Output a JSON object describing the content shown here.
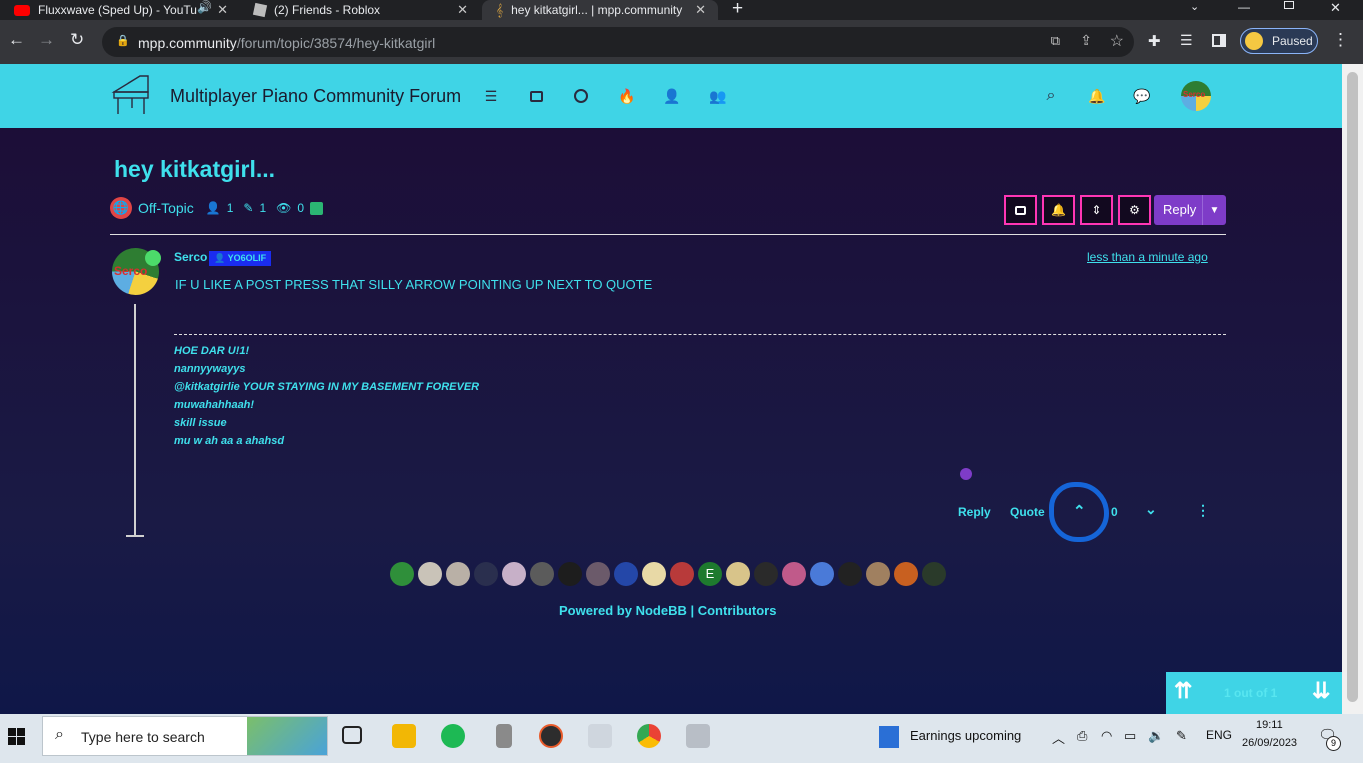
{
  "browser": {
    "tabs": [
      {
        "title": "Fluxxwave (Sped Up) - YouTu"
      },
      {
        "title": "(2) Friends - Roblox"
      },
      {
        "title": "hey kitkatgirl... | mpp.community"
      }
    ],
    "url_domain": "mpp.community",
    "url_path": "/forum/topic/38574/hey-kitkatgirl",
    "profile_label": "Paused"
  },
  "forum": {
    "brand": "Multiplayer Piano Community Forum",
    "nav_icons": [
      "list-icon",
      "inbox-icon",
      "clock-icon",
      "fire-icon",
      "user-icon",
      "users-icon"
    ],
    "header_right_icons": [
      "search-icon",
      "bell-icon",
      "chat-icon"
    ],
    "avatar_text": "Serco"
  },
  "topic": {
    "title": "hey kitkatgirl...",
    "category": "Off-Topic",
    "posters": "1",
    "posts": "1",
    "views": "0",
    "reply_label": "Reply"
  },
  "post": {
    "author": "Serco",
    "badge": "YO6OLIF",
    "time": "less than a minute ago",
    "content": "IF U LIKE A POST PRESS THAT SILLY ARROW POINTING UP NEXT TO QUOTE",
    "signature": [
      "HOE DAR U!1!",
      "nannyywayys",
      "@kitkatgirlie YOUR STAYING IN MY BASEMENT FOREVER",
      "muwahahhaah!",
      "skill issue",
      "mu w ah aa a ahahsd"
    ],
    "reply": "Reply",
    "quote": "Quote",
    "votes": "0",
    "avatar_text": "Serco"
  },
  "users_avatar_colors": [
    "#2f8f3a",
    "#c9c3b8",
    "#b9b0a6",
    "#2a2f4e",
    "#c7b0c8",
    "#5b5b5b",
    "#1d1d1d",
    "#6b5a6a",
    "#2447a8",
    "#e8d9a6",
    "#b83a3a",
    "#1e7a2e",
    "#d8c48a",
    "#2a2a2a",
    "#c05a8a",
    "#4a7ad8",
    "#222222",
    "#a08060",
    "#c86020",
    "#2a3a2a"
  ],
  "users_letter": "E",
  "footer": {
    "powered": "Powered by NodeBB | Contributors"
  },
  "pager": {
    "text": "1 out of 1"
  },
  "taskbar": {
    "search_placeholder": "Type here to search",
    "weather": "Earnings upcoming",
    "lang": "ENG",
    "time": "19:11",
    "date": "26/09/2023",
    "notifications": "9"
  }
}
